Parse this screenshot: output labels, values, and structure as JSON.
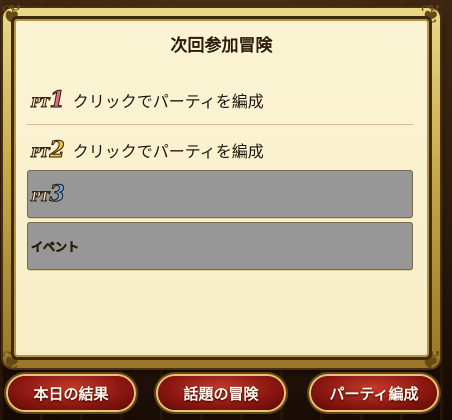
{
  "dialog": {
    "title": "次回参加冒険",
    "rows": [
      {
        "pt_label": "PT",
        "pt_number": "1",
        "text": "クリックでパーティを編成"
      },
      {
        "pt_label": "PT",
        "pt_number": "2",
        "text": "クリックでパーティを編成"
      },
      {
        "pt_label": "PT",
        "pt_number": "3",
        "text": ""
      },
      {
        "event_label": "イベント",
        "text": ""
      }
    ]
  },
  "buttons": {
    "today_results": "本日の結果",
    "trending_adventures": "話題の冒険",
    "party_formation": "パーティ編成"
  },
  "colors": {
    "paper": "#f7eec7",
    "gold_frame": "#c8a94a",
    "disabled_row": "#979797",
    "button_red": "#8a1610",
    "pt1": "#e86a8a",
    "pt2": "#f2c33a",
    "pt3": "#6fa0e0"
  },
  "icons": {
    "corners": "ornament-corner-icon"
  }
}
